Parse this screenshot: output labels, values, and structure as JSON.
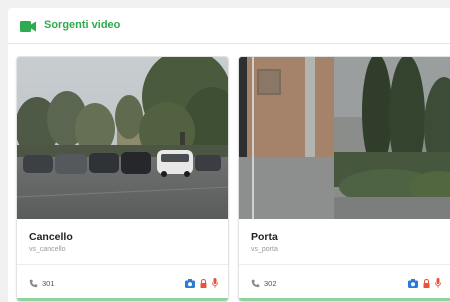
{
  "header": {
    "title": "Sorgenti video",
    "icon": "video-camera-icon",
    "accent_color": "#2eab4e"
  },
  "cards": [
    {
      "name": "Cancello",
      "id": "vs_cancello",
      "extension": "301",
      "icons": [
        "phone-icon",
        "camera-icon",
        "lock-icon",
        "microphone-icon"
      ]
    },
    {
      "name": "Porta",
      "id": "vs_porta",
      "extension": "302",
      "icons": [
        "phone-icon",
        "camera-icon",
        "lock-icon",
        "microphone-icon"
      ]
    }
  ],
  "colors": {
    "camera_icon": "#2b7bd6",
    "lock_icon": "#e5533d",
    "mic_icon": "#e5533d",
    "status_bar": "#8fd4a0"
  }
}
